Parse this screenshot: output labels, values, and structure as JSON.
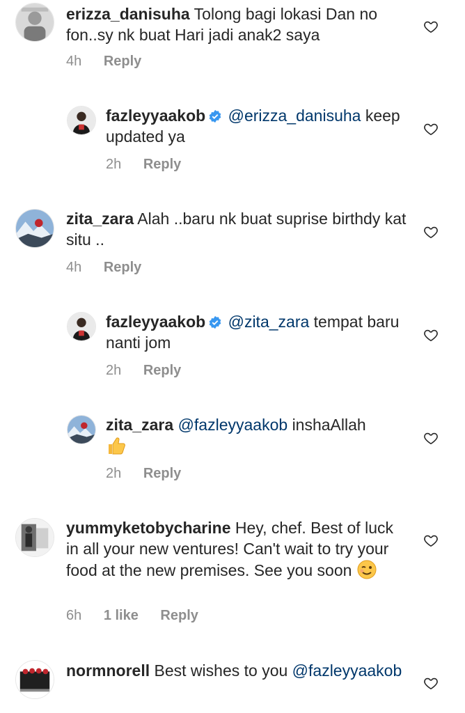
{
  "comments": [
    {
      "username": "erizza_danisuha",
      "text": "Tolong bagi lokasi Dan no fon..sy nk buat Hari jadi anak2 saya",
      "time": "4h",
      "reply_label": "Reply"
    },
    {
      "username": "fazleyyaakob",
      "mention": "@erizza_danisuha",
      "text": "keep updated ya",
      "time": "2h",
      "reply_label": "Reply"
    },
    {
      "username": "zita_zara",
      "text": "Alah ..baru nk buat suprise birthdy kat situ ..",
      "time": "4h",
      "reply_label": "Reply"
    },
    {
      "username": "fazleyyaakob",
      "mention": "@zita_zara",
      "text": "tempat baru nanti jom",
      "time": "2h",
      "reply_label": "Reply"
    },
    {
      "username": "zita_zara",
      "mention": "@fazleyyaakob",
      "text": "inshaAllah",
      "time": "2h",
      "reply_label": "Reply"
    },
    {
      "username": "yummyketobycharine",
      "text": "Hey, chef. Best of luck in all your new ventures! Can't wait to try your food at the new premises. See you soon",
      "time": "6h",
      "likes": "1 like",
      "reply_label": "Reply"
    },
    {
      "username": "normnorell",
      "text": "Best wishes to you",
      "mention": "@fazleyyaakob"
    }
  ],
  "colors": {
    "text": "#262626",
    "meta": "#8e8e8e",
    "mention": "#00376b",
    "verified": "#3897f0"
  },
  "icons": [
    "heart-icon",
    "verified-badge-icon",
    "thumbs-up-emoji",
    "winking-face-emoji"
  ]
}
